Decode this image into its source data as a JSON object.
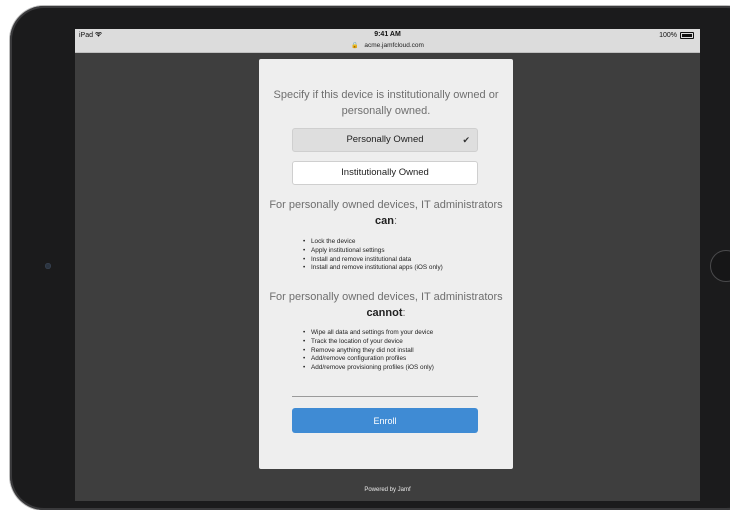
{
  "status_bar": {
    "device": "iPad",
    "wifi_icon": "wifi-icon",
    "time": "9:41 AM",
    "battery": "100%"
  },
  "url_bar": {
    "lock_icon": "lock-icon",
    "url": "acme.jamfcloud.com"
  },
  "enrollment": {
    "prompt": "Specify if this device is institutionally owned or personally owned.",
    "options": [
      {
        "label": "Personally Owned",
        "selected": true
      },
      {
        "label": "Institutionally Owned",
        "selected": false
      }
    ],
    "can_heading_prefix": "For personally owned devices, IT administrators",
    "can_emphasis": "can",
    "can_suffix": ":",
    "can_items": [
      "Lock the device",
      "Apply institutional settings",
      "Install and remove institutional data",
      "Install and remove institutional apps (iOS only)"
    ],
    "cannot_heading_prefix": "For personally owned devices, IT administrators",
    "cannot_emphasis": "cannot",
    "cannot_suffix": ":",
    "cannot_items": [
      "Wipe all data and settings from your device",
      "Track the location of your device",
      "Remove anything they did not install",
      "Add/remove configuration profiles",
      "Add/remove provisioning profiles (iOS only)"
    ],
    "enroll_label": "Enroll"
  },
  "footer": {
    "text": "Powered by Jamf"
  },
  "colors": {
    "accent": "#3f8bd4",
    "card": "#eeeeee",
    "backdrop": "#3e3e3e"
  }
}
